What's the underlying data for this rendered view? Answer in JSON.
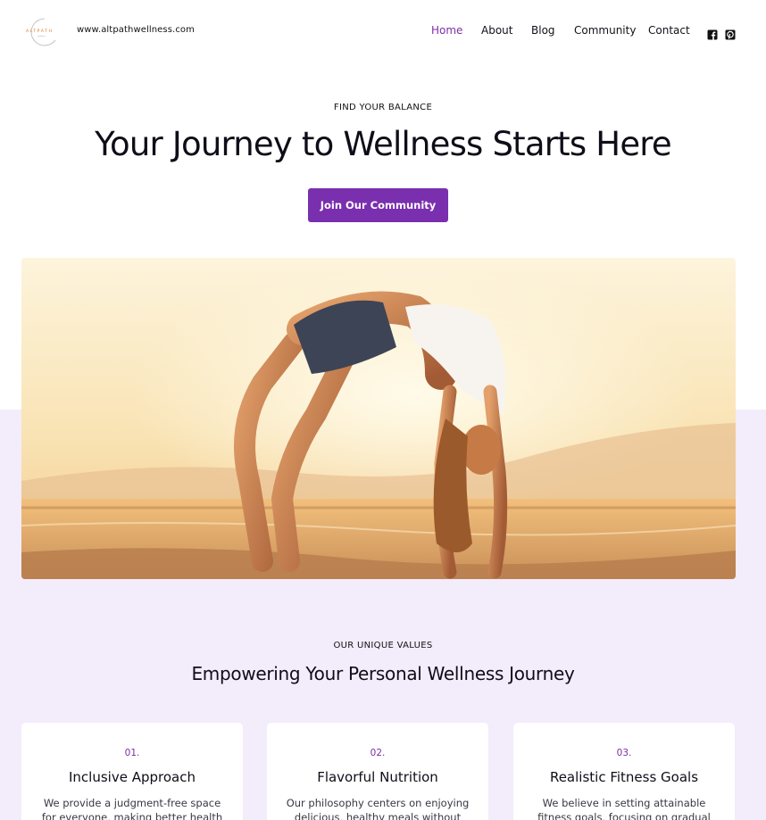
{
  "header": {
    "logo_text": "ALTPATH",
    "site_url": "www.altpathwellness.com",
    "nav": [
      "Home",
      "About",
      "Blog",
      "Community",
      "Contact"
    ],
    "active_nav": "Home",
    "social_icons": [
      "facebook-icon",
      "pinterest-icon"
    ]
  },
  "hero": {
    "eyebrow": "FIND YOUR BALANCE",
    "title": "Your Journey to Wellness Starts Here",
    "cta_label": "Join Our Community",
    "image_alt": "Woman doing a backbend yoga pose on a beach at sunset"
  },
  "values": {
    "eyebrow": "OUR UNIQUE VALUES",
    "title": "Empowering Your Personal Wellness Journey",
    "cards": [
      {
        "num": "01.",
        "title": "Inclusive Approach",
        "desc": "We provide a judgment-free space for everyone, making better health"
      },
      {
        "num": "02.",
        "title": "Flavorful Nutrition",
        "desc": "Our philosophy centers on enjoying delicious, healthy meals without guilt"
      },
      {
        "num": "03.",
        "title": "Realistic Fitness Goals",
        "desc": "We believe in setting attainable fitness goals, focusing on gradual progress"
      }
    ]
  },
  "colors": {
    "accent": "#7a2fae",
    "band": "#f3ecfb",
    "text": "#0f0d18"
  }
}
